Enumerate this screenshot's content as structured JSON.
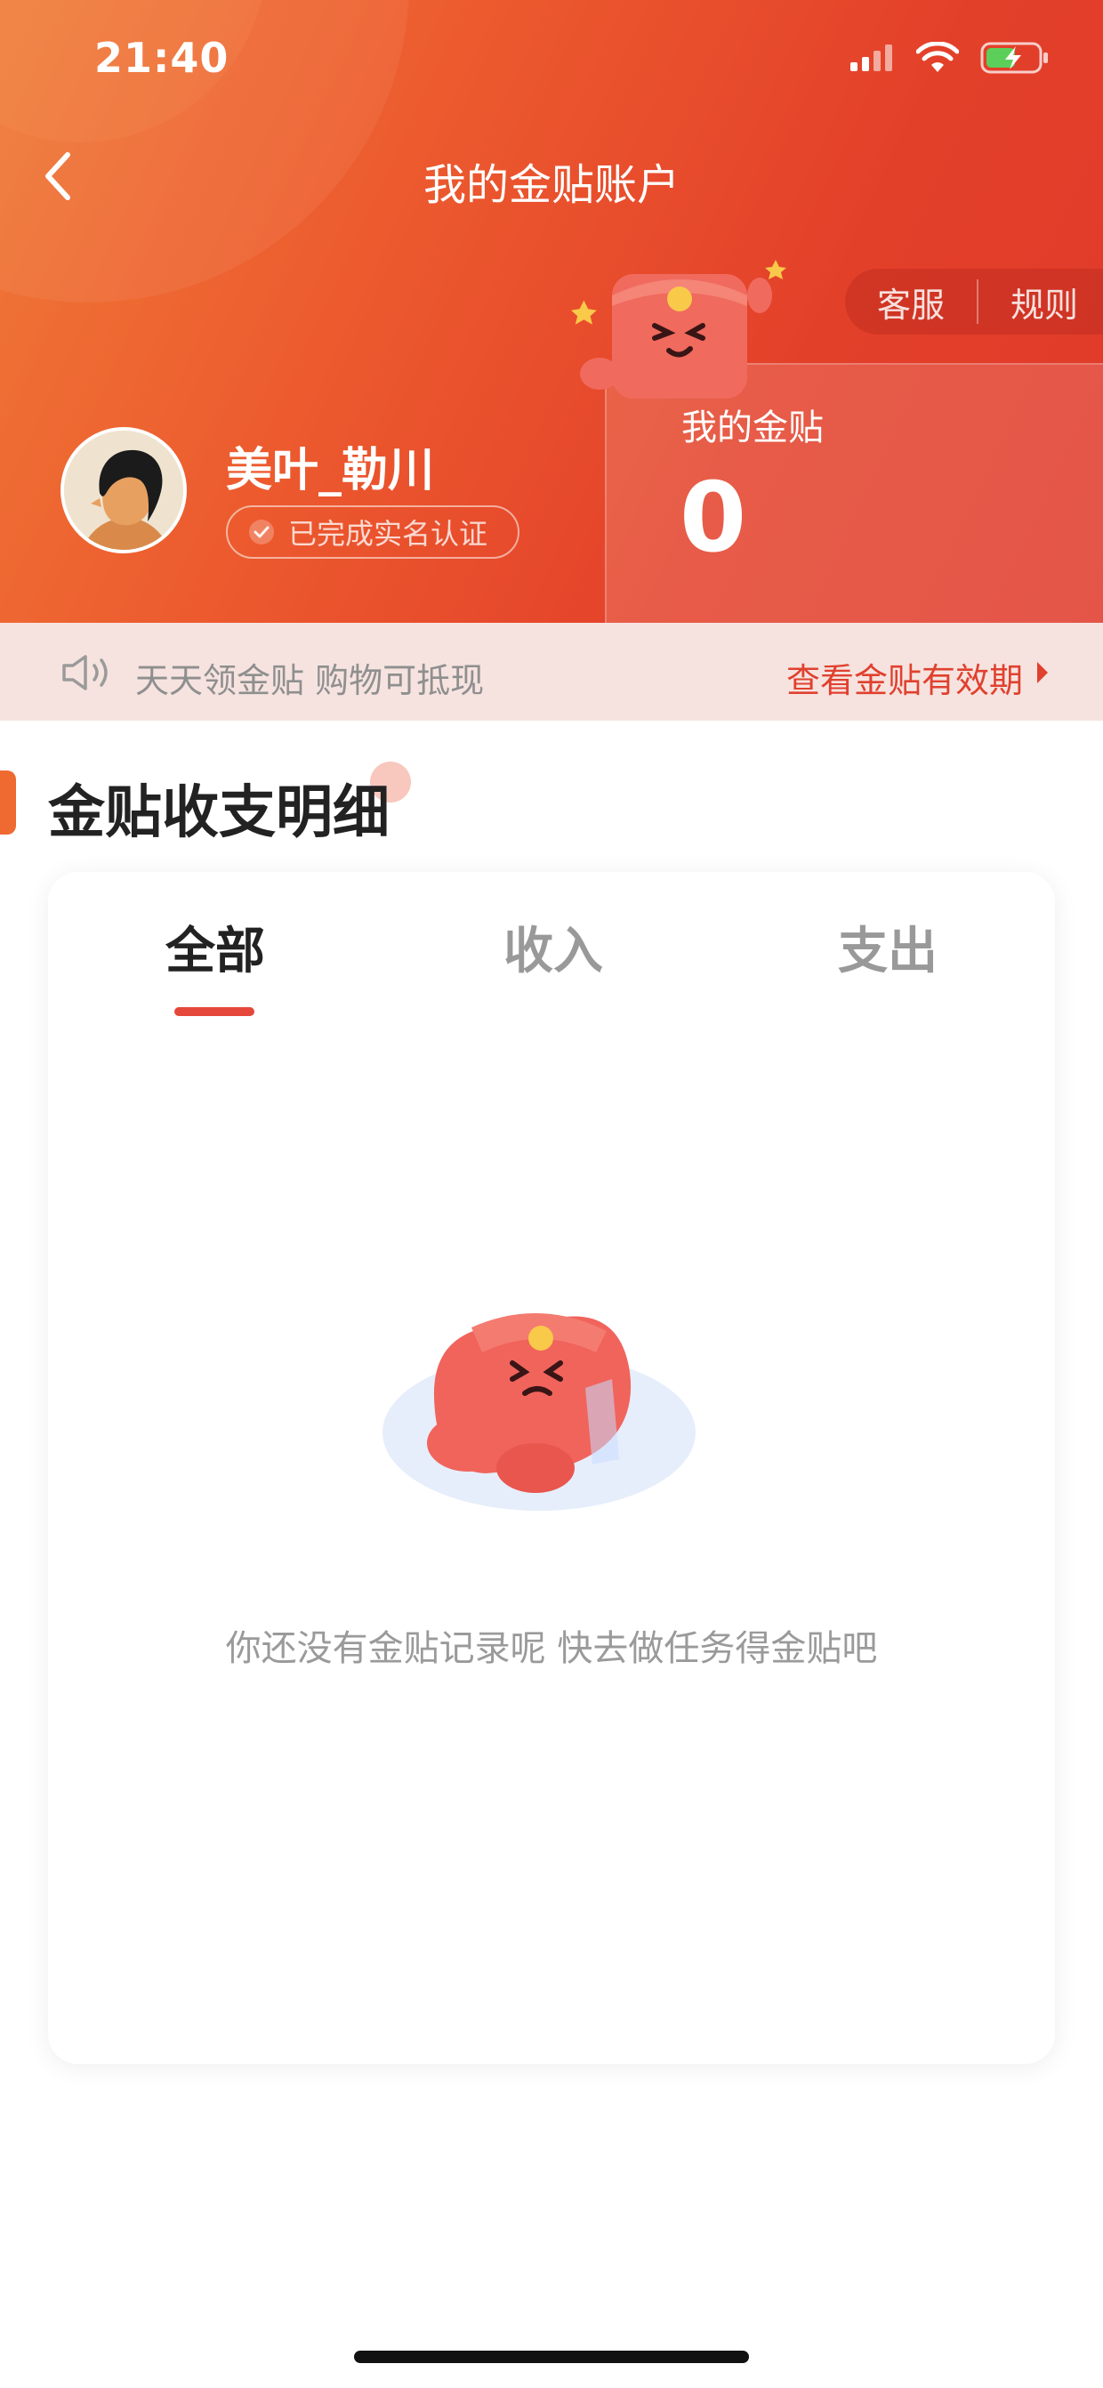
{
  "status_bar": {
    "time": "21:40"
  },
  "header": {
    "title": "我的金贴账户"
  },
  "top_actions": {
    "service": "客服",
    "rules": "规则"
  },
  "user": {
    "name": "美叶_勒川",
    "verified_label": "已完成实名认证"
  },
  "balance": {
    "label": "我的金贴",
    "value": "0"
  },
  "notice": {
    "text": "天天领金贴 购物可抵现",
    "link": "查看金贴有效期"
  },
  "section": {
    "title": "金贴收支明细"
  },
  "tabs": [
    {
      "label": "全部",
      "active": true
    },
    {
      "label": "收入",
      "active": false
    },
    {
      "label": "支出",
      "active": false
    }
  ],
  "empty_state": {
    "message": "你还没有金贴记录呢 快去做任务得金贴吧"
  },
  "colors": {
    "accent": "#e6473b",
    "hero_start": "#f07a38",
    "hero_end": "#e03a2a",
    "link": "#e0412f"
  }
}
